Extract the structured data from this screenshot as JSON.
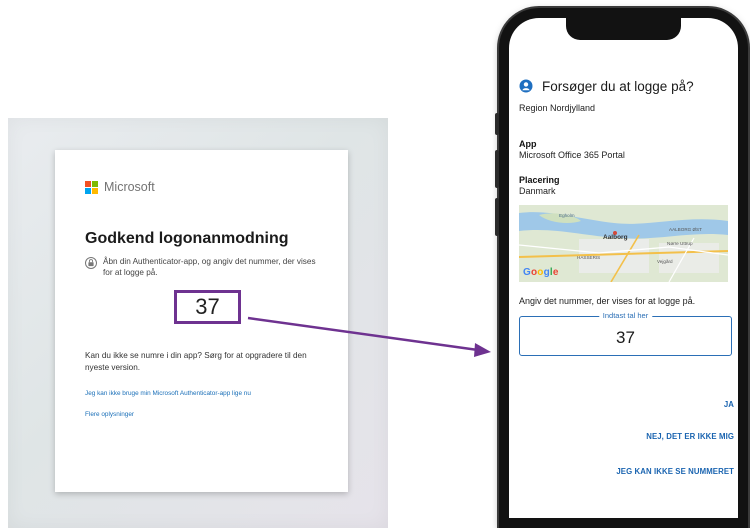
{
  "browser_card": {
    "logo_text": "Microsoft",
    "logo_colors": [
      "#f25022",
      "#7fba00",
      "#00a4ef",
      "#ffb900"
    ],
    "title": "Godkend logonanmodning",
    "instruction_icon": "authenticator-lock-icon",
    "instruction": "Åbn din Authenticator-app, og angiv det nummer, der vises for at logge på.",
    "number": "37",
    "help_text": "Kan du ikke se numre i din app? Sørg for at opgradere til den nyeste version.",
    "link_cannot_use": "Jeg kan ikke bruge min Microsoft Authenticator-app lige nu",
    "link_more_info": "Flere oplysninger"
  },
  "phone": {
    "prompt_icon": "authenticator-lock-icon",
    "title": "Forsøger du at logge på?",
    "organization": "Region Nordjylland",
    "app_label": "App",
    "app_value": "Microsoft Office 365 Portal",
    "location_label": "Placering",
    "location_value": "Danmark",
    "map": {
      "labels": [
        "Egholm",
        "Aalborg",
        "AALBORG ØST",
        "HASSERIS",
        "Vejgård",
        "Nørre Uttrup"
      ],
      "attribution": "Google"
    },
    "enter_prompt": "Angiv det nummer, der vises for at logge på.",
    "field_legend": "Indtast tal her",
    "field_value": "37",
    "btn_yes": "JA",
    "btn_no": "NEJ, DET ER IKKE MIG",
    "btn_cannot_see": "JEG KAN IKKE SE NUMMERET"
  },
  "colors": {
    "highlight_box": "#6e3290",
    "arrow": "#6e3290",
    "link": "#1a6fb8",
    "phone_accent": "#2b6fb6"
  }
}
